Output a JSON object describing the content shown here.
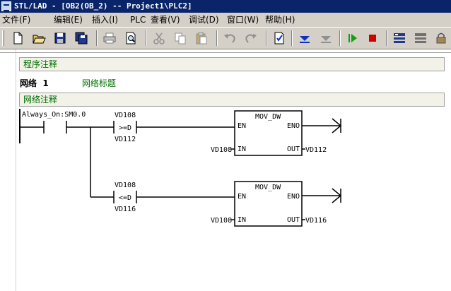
{
  "window": {
    "title": "STL/LAD - [OB2(OB_2) -- Project1\\PLC2]"
  },
  "menu": [
    {
      "label": "文件(F)"
    },
    {
      "label": "编辑(E)"
    },
    {
      "label": "插入(I)"
    },
    {
      "label": "PLC"
    },
    {
      "label": "查看(V)"
    },
    {
      "label": "调试(D)"
    },
    {
      "label": "窗口(W)"
    },
    {
      "label": "帮助(H)"
    }
  ],
  "toolbar": {
    "buttons": [
      {
        "icon": "new-file-icon"
      },
      {
        "icon": "open-folder-icon"
      },
      {
        "icon": "save-icon"
      },
      {
        "icon": "save-all-icon"
      },
      {
        "icon": "print-icon"
      },
      {
        "icon": "print-preview-icon"
      },
      {
        "icon": "cut-icon"
      },
      {
        "icon": "copy-icon"
      },
      {
        "icon": "paste-icon"
      },
      {
        "icon": "undo-icon"
      },
      {
        "icon": "redo-icon"
      },
      {
        "icon": "check-document-icon"
      },
      {
        "icon": "download-icon"
      },
      {
        "icon": "upload-icon"
      },
      {
        "icon": "run-icon"
      },
      {
        "icon": "stop-icon"
      },
      {
        "icon": "monitor-icon"
      },
      {
        "icon": "overview-icon"
      },
      {
        "icon": "lock-icon"
      }
    ],
    "colors": {
      "run": "#10a010",
      "stop": "#d00000",
      "download": "#1030c0"
    }
  },
  "editor": {
    "program_comment": "程序注释",
    "network": {
      "label": "网络",
      "number": "1",
      "title": "网络标题",
      "comment": "网络注释"
    },
    "ladder": {
      "contact_label": "Always_On:SM0.0",
      "comparators": [
        {
          "top_operand": "VD108",
          "op": ">=D",
          "bottom_operand": "VD112"
        },
        {
          "top_operand": "VD108",
          "op": "<=D",
          "bottom_operand": "VD116"
        }
      ],
      "boxes": [
        {
          "name": "MOV_DW",
          "en": "EN",
          "eno": "ENO",
          "in_label": "IN",
          "out_label": "OUT",
          "in_operand": "VD108",
          "out_operand": "VD112"
        },
        {
          "name": "MOV_DW",
          "en": "EN",
          "eno": "ENO",
          "in_label": "IN",
          "out_label": "OUT",
          "in_operand": "VD108",
          "out_operand": "VD116"
        }
      ]
    },
    "colors": {
      "comment_text": "#007000",
      "comment_bg": "#f2f2e9"
    }
  }
}
